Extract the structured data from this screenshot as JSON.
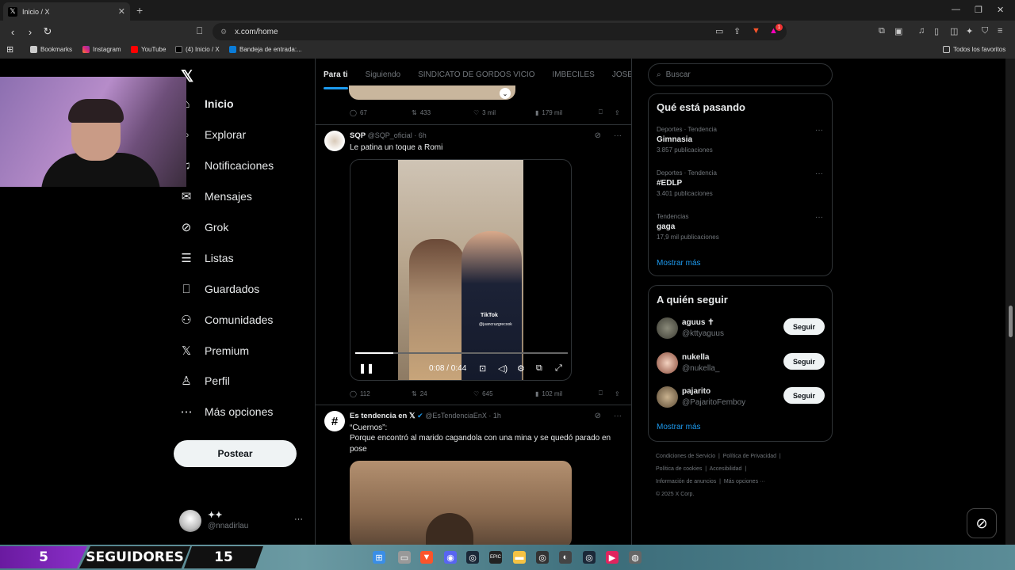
{
  "browser": {
    "tab_title": "Inicio / X",
    "url": "x.com/home",
    "bookmarks": [
      {
        "label": "Bookmarks",
        "icon": "folder-icon"
      },
      {
        "label": "Instagram",
        "icon": "instagram-icon"
      },
      {
        "label": "YouTube",
        "icon": "youtube-icon"
      },
      {
        "label": "(4) Inicio / X",
        "icon": "x-icon"
      },
      {
        "label": "Bandeja de entrada:...",
        "icon": "mail-icon"
      }
    ],
    "favorites": "Todos los favoritos",
    "brave_badge": "1"
  },
  "sidebar": {
    "items": [
      {
        "label": "Inicio",
        "icon": "home-icon",
        "glyph": "⌂"
      },
      {
        "label": "Explorar",
        "icon": "search-icon",
        "glyph": "⌕"
      },
      {
        "label": "Notificaciones",
        "icon": "bell-icon",
        "glyph": "♫"
      },
      {
        "label": "Mensajes",
        "icon": "mail-icon",
        "glyph": "✉"
      },
      {
        "label": "Grok",
        "icon": "grok-icon",
        "glyph": "⊘"
      },
      {
        "label": "Listas",
        "icon": "list-icon",
        "glyph": "☰"
      },
      {
        "label": "Guardados",
        "icon": "bookmark-icon",
        "glyph": "⎕"
      },
      {
        "label": "Comunidades",
        "icon": "communities-icon",
        "glyph": "⚇"
      },
      {
        "label": "Premium",
        "icon": "x-premium-icon",
        "glyph": "𝕏"
      },
      {
        "label": "Perfil",
        "icon": "person-icon",
        "glyph": "♙"
      },
      {
        "label": "Más opciones",
        "icon": "more-circle-icon",
        "glyph": "⋯"
      }
    ],
    "post_button": "Postear",
    "profile": {
      "name": "✦✦",
      "handle": "@nnadirlau"
    }
  },
  "timeline": {
    "tabs": [
      "Para ti",
      "Siguiendo",
      "SINDICATO DE GORDOS VICIO",
      "IMBECILES",
      "JOSEC"
    ],
    "top_actions": {
      "replies": "67",
      "reposts": "433",
      "likes": "3 mil",
      "views": "179 mil"
    },
    "tweets": [
      {
        "name": "SQP",
        "handle": "@SQP_oficial",
        "time": "· 6h",
        "text": "Le patina un toque a Romi",
        "video": {
          "time": "0:08 / 0:44",
          "progress": 0.18,
          "watermark": "TikTok",
          "watermark_handle": "@juancruzgrecook"
        },
        "actions": {
          "replies": "112",
          "reposts": "24",
          "likes": "645",
          "views": "102 mil"
        }
      },
      {
        "name": "Es tendencia en 𝕏",
        "handle": "@EsTendenciaEnX",
        "time": "· 1h",
        "text_line1": "“Cuernos”:",
        "text_line2": "Porque encontró al marido cagandola con una mina y se quedó parado en pose"
      }
    ]
  },
  "right": {
    "search_placeholder": "Buscar",
    "trends_title": "Qué está pasando",
    "trends": [
      {
        "category": "Deportes · Tendencia",
        "name": "Gimnasia",
        "count": "3.857 publicaciones"
      },
      {
        "category": "Deportes · Tendencia",
        "name": "#EDLP",
        "count": "3.401 publicaciones"
      },
      {
        "category": "Tendencias",
        "name": "gaga",
        "count": "17,9 mil publicaciones"
      }
    ],
    "show_more": "Mostrar más",
    "follow_title": "A quién seguir",
    "follow": [
      {
        "name": "aguus ✝",
        "handle": "@kttyaguus",
        "button": "Seguir"
      },
      {
        "name": "nukella",
        "handle": "@nukella_",
        "button": "Seguir"
      },
      {
        "name": "pajarito",
        "handle": "@PajaritoFemboy",
        "button": "Seguir"
      }
    ],
    "footer": {
      "l1a": "Condiciones de Servicio",
      "l1b": "Política de Privacidad",
      "l2a": "Política de cookies",
      "l2b": "Accesibilidad",
      "l3a": "Información de anuncios",
      "l3b": "Más opciones ···",
      "l4": "© 2025 X Corp."
    }
  },
  "overlay": {
    "followers_count": "5",
    "followers_label": "SEGUIDORES",
    "followers_goal": "15"
  },
  "colors": {
    "accent": "#1d9bf0",
    "background": "#000000",
    "muted": "#71767b"
  }
}
